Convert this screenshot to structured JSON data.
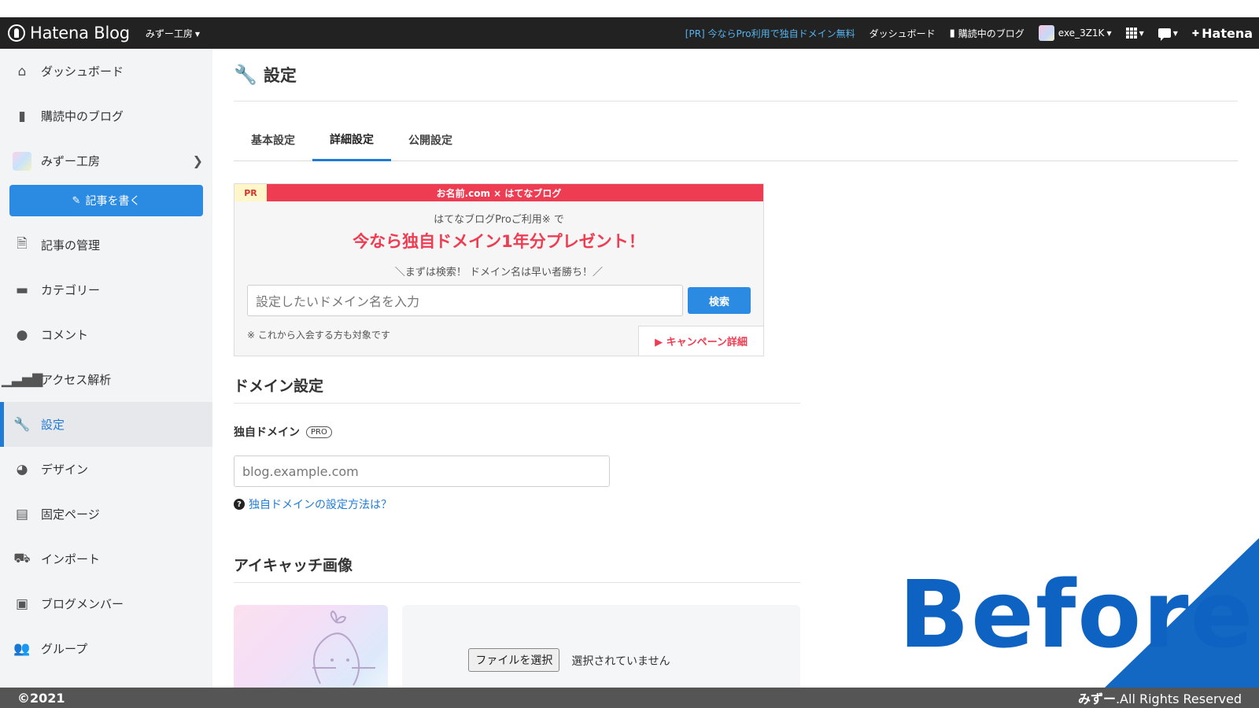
{
  "header": {
    "logo": "Hatena Blog",
    "blog_name": "みずー工房",
    "pr_link": "[PR] 今ならPro利用で独自ドメイン無料",
    "dashboard": "ダッシュボード",
    "subscribed": "購読中のブログ",
    "username": "exe_3Z1K",
    "hatena": "Hatena",
    "colors": {
      "bar": "#222222",
      "pr_link": "#56b3ee"
    }
  },
  "sidebar": {
    "items": [
      {
        "label": "ダッシュボード",
        "icon": "home-icon"
      },
      {
        "label": "購読中のブログ",
        "icon": "bookmark-icon"
      },
      {
        "label": "みずー工房",
        "icon": "blog-avatar"
      },
      {
        "label": "記事の管理",
        "icon": "document-icon"
      },
      {
        "label": "カテゴリー",
        "icon": "folder-icon"
      },
      {
        "label": "コメント",
        "icon": "comment-icon"
      },
      {
        "label": "アクセス解析",
        "icon": "bar-chart-icon"
      },
      {
        "label": "設定",
        "icon": "wrench-icon",
        "active": true
      },
      {
        "label": "デザイン",
        "icon": "palette-icon"
      },
      {
        "label": "固定ページ",
        "icon": "page-icon"
      },
      {
        "label": "インポート",
        "icon": "truck-icon"
      },
      {
        "label": "ブログメンバー",
        "icon": "member-icon"
      },
      {
        "label": "グループ",
        "icon": "group-icon"
      }
    ],
    "write_button": "記事を書く",
    "accent": "#1f7bd6"
  },
  "main": {
    "title": "設定",
    "tabs": [
      {
        "label": "基本設定"
      },
      {
        "label": "詳細設定",
        "active": true
      },
      {
        "label": "公開設定"
      }
    ],
    "promo": {
      "pr_tag": "PR",
      "bar_text": "お名前.com × はてなブログ",
      "sub": "はてなブログProご利用※ で",
      "headline": "今なら独自ドメイン1年分プレゼント！",
      "note": "＼まずは検索！ ドメイン名は早い者勝ち！／",
      "search_placeholder": "設定したいドメイン名を入力",
      "search_button": "検索",
      "footnote": "※ これから入会する方も対象です",
      "detail_link": "▶ キャンペーン詳細",
      "color": "#ee3c52"
    },
    "domain_section": {
      "title": "ドメイン設定",
      "label": "独自ドメイン",
      "badge": "PRO",
      "placeholder": "blog.example.com",
      "help": "独自ドメインの設定方法は？"
    },
    "eyecatch_section": {
      "title": "アイキャッチ画像",
      "file_button": "ファイルを選択",
      "file_status": "選択されていません"
    }
  },
  "overlay": {
    "label": "Before",
    "color": "#0e63c2"
  },
  "footer": {
    "left": "©2021",
    "right_bold": "みずー",
    "right": ".All Rights Reserved"
  }
}
